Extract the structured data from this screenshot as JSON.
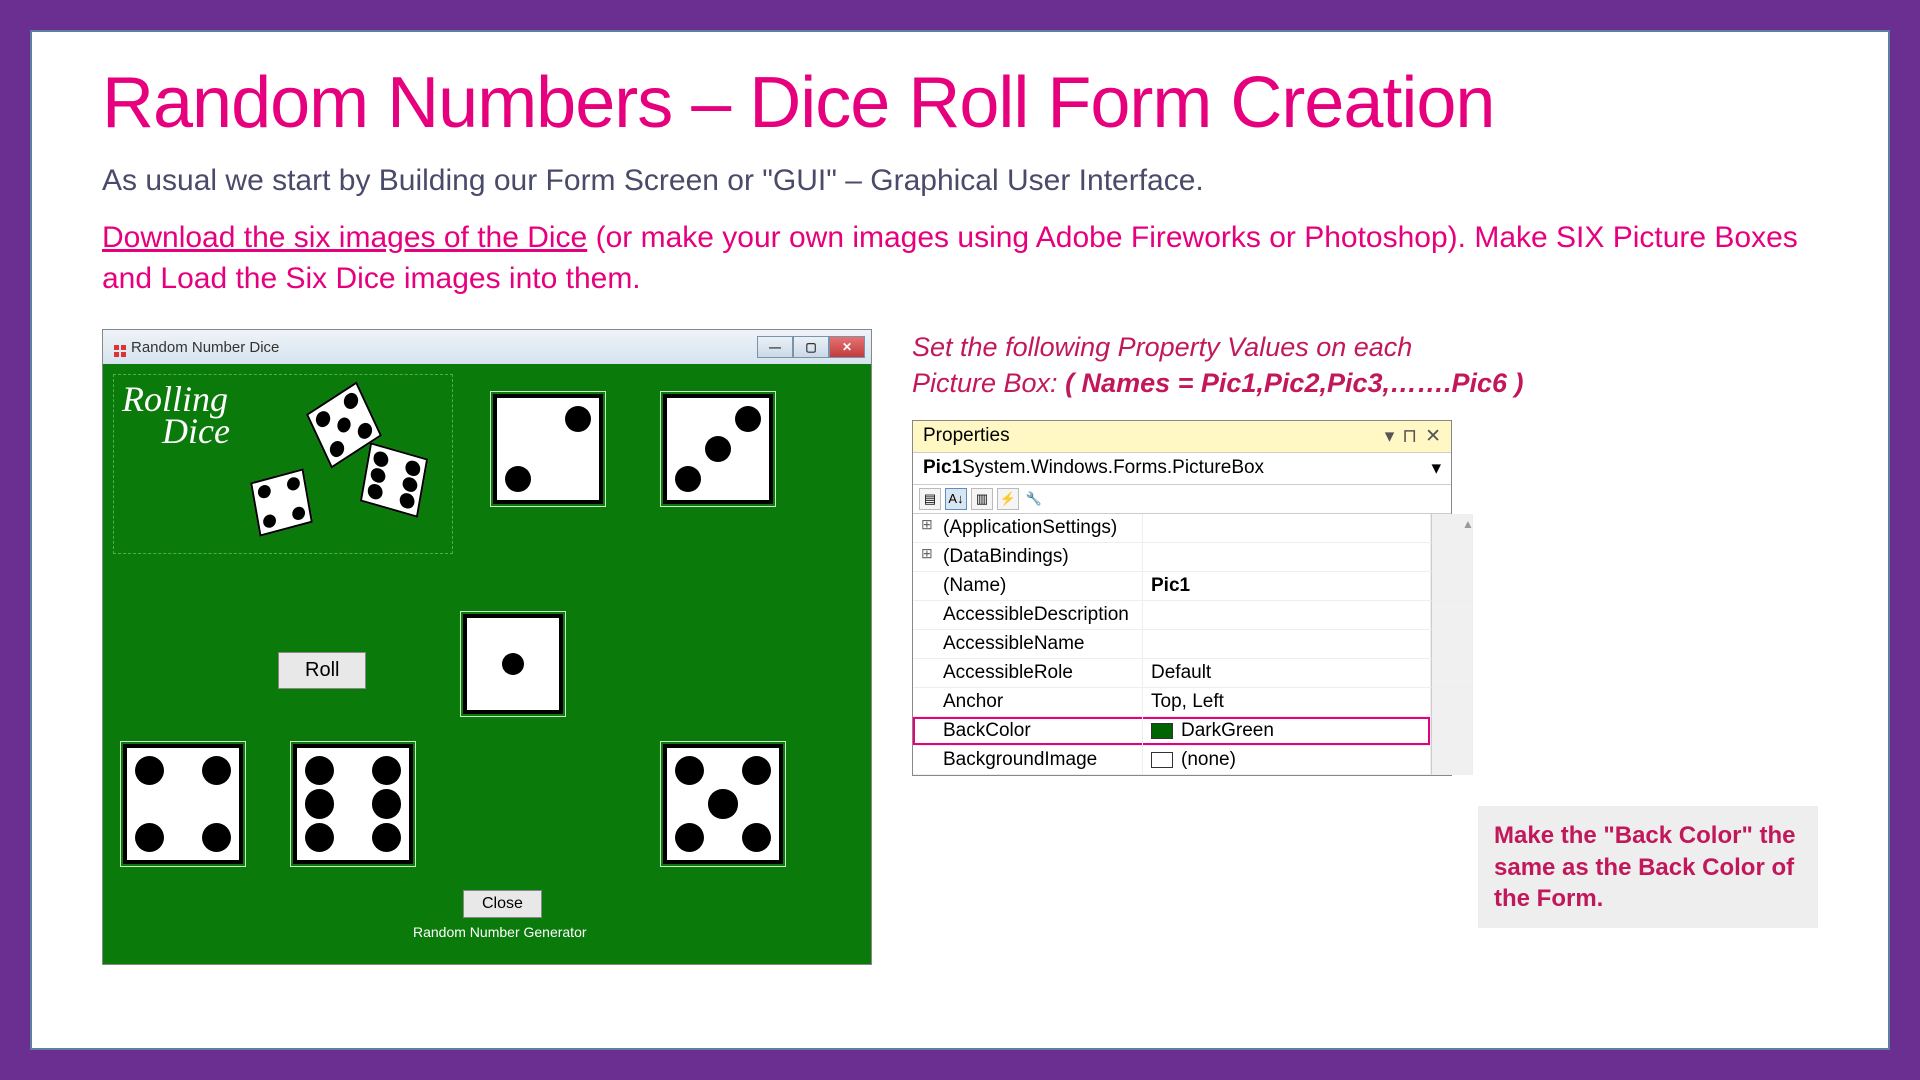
{
  "title": "Random Numbers – Dice Roll Form Creation",
  "intro": "As usual we start by Building our Form Screen or \"GUI\" – Graphical User Interface.",
  "download": {
    "link_text": "Download the six images of the Dice",
    "rest": " (or make your own images using Adobe Fireworks or Photoshop). Make SIX Picture Boxes and Load the Six Dice images into them."
  },
  "form": {
    "title": "Random Number Dice",
    "logo_line1": "Rolling",
    "logo_line2": "Dice",
    "roll_button": "Roll",
    "close_button": "Close",
    "footer": "Random Number Generator"
  },
  "right": {
    "instr_line1": "Set the following Property Values on each",
    "instr_line2_a": "Picture Box:  ",
    "instr_names": "( Names = Pic1,Pic2,Pic3,…….Pic6 )"
  },
  "props": {
    "header": "Properties",
    "object_bold": "Pic1",
    "object_rest": " System.Windows.Forms.PictureBox",
    "rows": [
      {
        "name": "(ApplicationSettings)",
        "value": "",
        "expand": true
      },
      {
        "name": "(DataBindings)",
        "value": "",
        "expand": true
      },
      {
        "name": "(Name)",
        "value": "Pic1",
        "bold": true
      },
      {
        "name": "AccessibleDescription",
        "value": ""
      },
      {
        "name": "AccessibleName",
        "value": ""
      },
      {
        "name": "AccessibleRole",
        "value": "Default"
      },
      {
        "name": "Anchor",
        "value": "Top, Left"
      },
      {
        "name": "BackColor",
        "value": "DarkGreen",
        "swatch": "color",
        "highlight": true
      },
      {
        "name": "BackgroundImage",
        "value": "(none)",
        "swatch": "none"
      }
    ]
  },
  "callout": "Make the \"Back Color\" the same as the Back Color of the Form."
}
